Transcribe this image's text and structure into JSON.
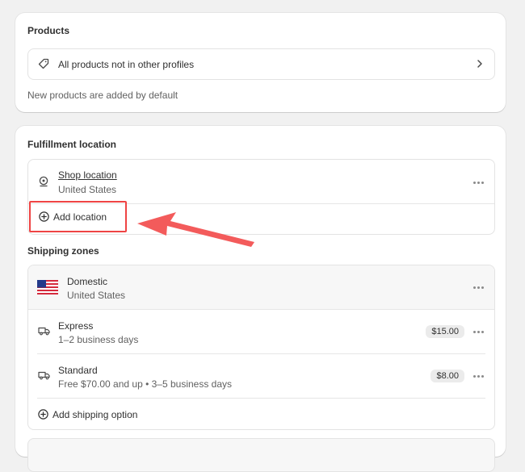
{
  "products": {
    "title": "Products",
    "item_label": "All products not in other profiles",
    "note": "New products are added by default"
  },
  "fulfillment": {
    "title": "Fulfillment location",
    "location_name": "Shop location",
    "location_country": "United States",
    "add_location_label": "Add location"
  },
  "shipping": {
    "title": "Shipping zones",
    "zone_name": "Domestic",
    "zone_country": "United States",
    "options": [
      {
        "name": "Express",
        "detail": "1–2 business days",
        "price": "$15.00"
      },
      {
        "name": "Standard",
        "detail": "Free $70.00 and up • 3–5 business days",
        "price": "$8.00"
      }
    ],
    "add_option_label": "Add shipping option"
  },
  "annotation": {
    "highlight_color": "#ef4444"
  },
  "icons": [
    "tag-icon",
    "chevron-right-icon",
    "location-pin-icon",
    "plus-circle-icon",
    "us-flag-icon",
    "truck-icon",
    "more-horizontal-icon"
  ]
}
